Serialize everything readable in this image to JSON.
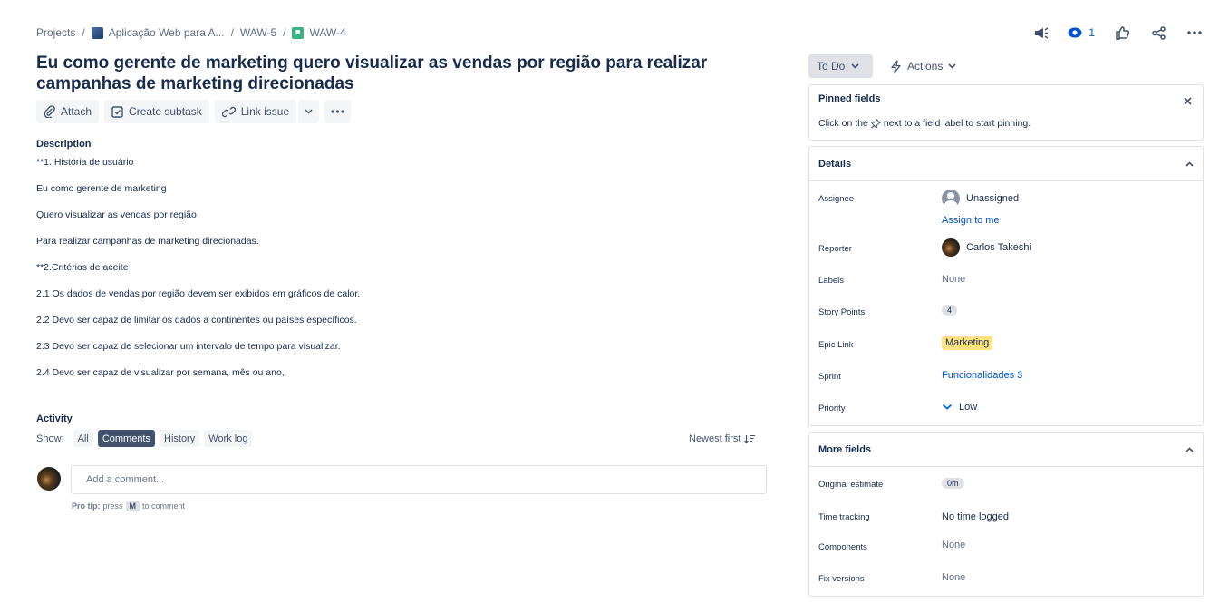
{
  "breadcrumb": {
    "projects": "Projects",
    "project": "Aplicação Web para A...",
    "epic": "WAW-5",
    "issue": "WAW-4"
  },
  "header": {
    "watch_count": "1"
  },
  "issue": {
    "title": "Eu como gerente de marketing quero visualizar as vendas por região para realizar campanhas de marketing direcionadas"
  },
  "toolbar": {
    "attach": "Attach",
    "create_subtask": "Create subtask",
    "link_issue": "Link issue"
  },
  "description": {
    "label": "Description",
    "lines": [
      "**1. História de usuário",
      "Eu como gerente de marketing",
      "Quero visualizar as vendas por região",
      "Para realizar campanhas de marketing direcionadas.",
      "**2.Critérios de aceite",
      "2.1 Os dados de vendas por região devem ser exibidos em gráficos de calor.",
      "2.2 Devo ser capaz de limitar os dados a continentes ou países específicos.",
      "2.3 Devo ser capaz de selecionar um intervalo de tempo para visualizar.",
      "2.4 Devo ser capaz de visualizar por semana, mês ou ano,"
    ]
  },
  "activity": {
    "label": "Activity",
    "show_label": "Show:",
    "filters": [
      "All",
      "Comments",
      "History",
      "Work log"
    ],
    "active_filter": "Comments",
    "sort": "Newest first",
    "comment_placeholder": "Add a comment...",
    "protip_label": "Pro tip:",
    "protip_press": "press",
    "protip_key": "M",
    "protip_suffix": "to comment"
  },
  "status": {
    "label": "To Do",
    "actions": "Actions"
  },
  "pinned": {
    "title": "Pinned fields",
    "text_before": "Click on the",
    "text_after": "next to a field label to start pinning."
  },
  "details": {
    "title": "Details",
    "assignee_label": "Assignee",
    "assignee_value": "Unassigned",
    "assign_to_me": "Assign to me",
    "reporter_label": "Reporter",
    "reporter_value": "Carlos Takeshi",
    "labels_label": "Labels",
    "labels_value": "None",
    "story_points_label": "Story Points",
    "story_points_value": "4",
    "epic_link_label": "Epic Link",
    "epic_link_value": "Marketing",
    "sprint_label": "Sprint",
    "sprint_value": "Funcionalidades 3",
    "priority_label": "Priority",
    "priority_value": "Low"
  },
  "more_fields": {
    "title": "More fields",
    "original_estimate_label": "Original estimate",
    "original_estimate_value": "0m",
    "time_tracking_label": "Time tracking",
    "time_tracking_value": "No time logged",
    "components_label": "Components",
    "components_value": "None",
    "fix_versions_label": "Fix versions",
    "fix_versions_value": "None"
  },
  "colors": {
    "link": "#0052cc",
    "active_filter_bg": "#42526e",
    "epic_bg": "#ffe380",
    "story_icon": "#36b37e"
  }
}
